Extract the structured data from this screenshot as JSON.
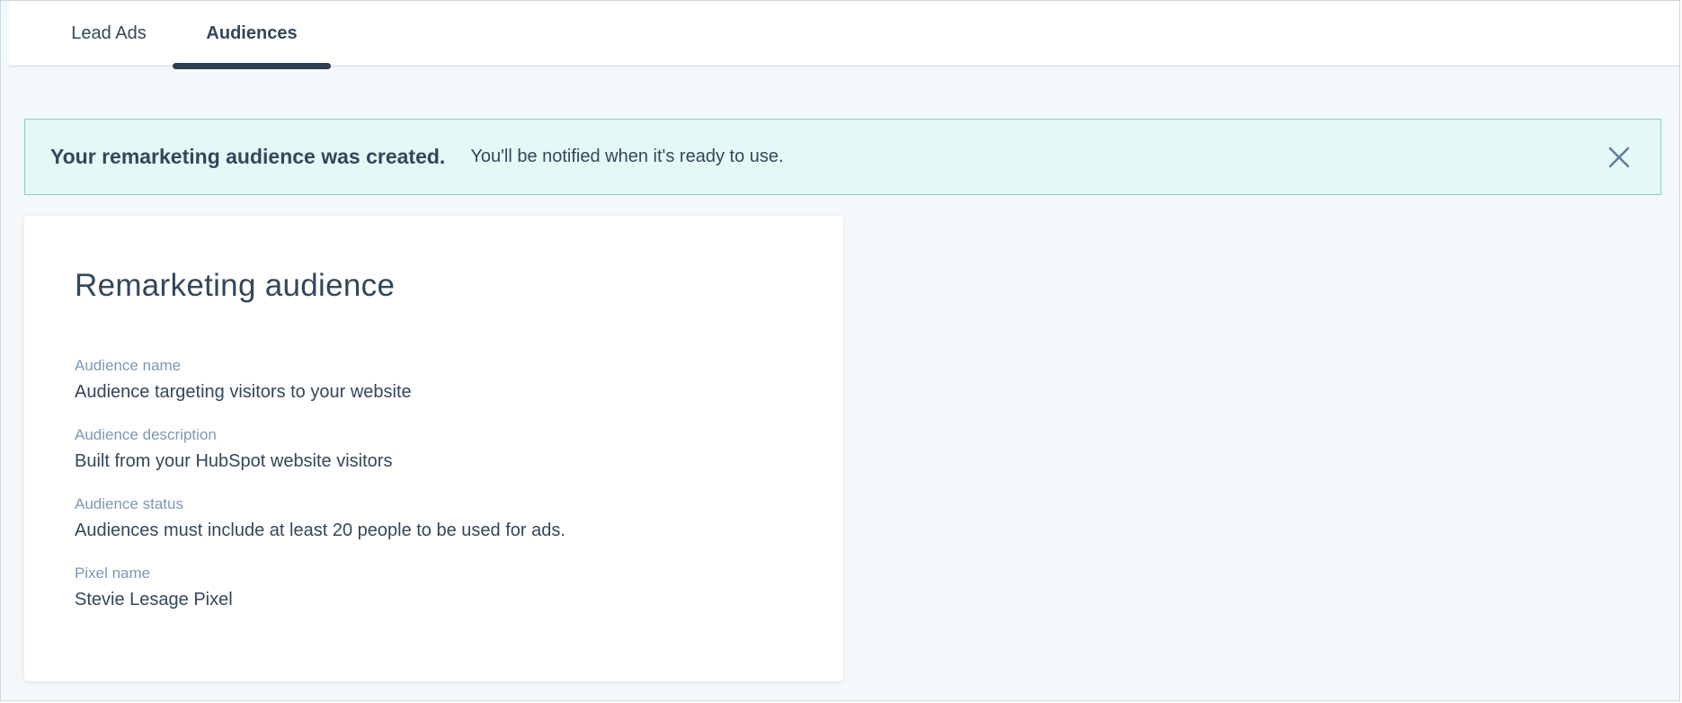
{
  "tabs": [
    {
      "label": "Lead Ads",
      "active": false
    },
    {
      "label": "Audiences",
      "active": true
    }
  ],
  "alert": {
    "title": "Your remarketing audience was created.",
    "message": "You'll be notified when it's ready to use.",
    "close_icon": "close-icon",
    "background": "#e5f8f6",
    "border": "#7fd1c7"
  },
  "card": {
    "title": "Remarketing audience",
    "fields": [
      {
        "label": "Audience name",
        "value": "Audience targeting visitors to your website"
      },
      {
        "label": "Audience description",
        "value": "Built from your HubSpot website visitors"
      },
      {
        "label": "Audience status",
        "value": "Audiences must include at least 20 people to be used for ads."
      },
      {
        "label": "Pixel name",
        "value": "Stevie Lesage Pixel"
      }
    ]
  },
  "colors": {
    "text": "#33475b",
    "label": "#7c98b6",
    "tab_indicator": "#2d3e50",
    "page_background": "#f5f8fa"
  }
}
